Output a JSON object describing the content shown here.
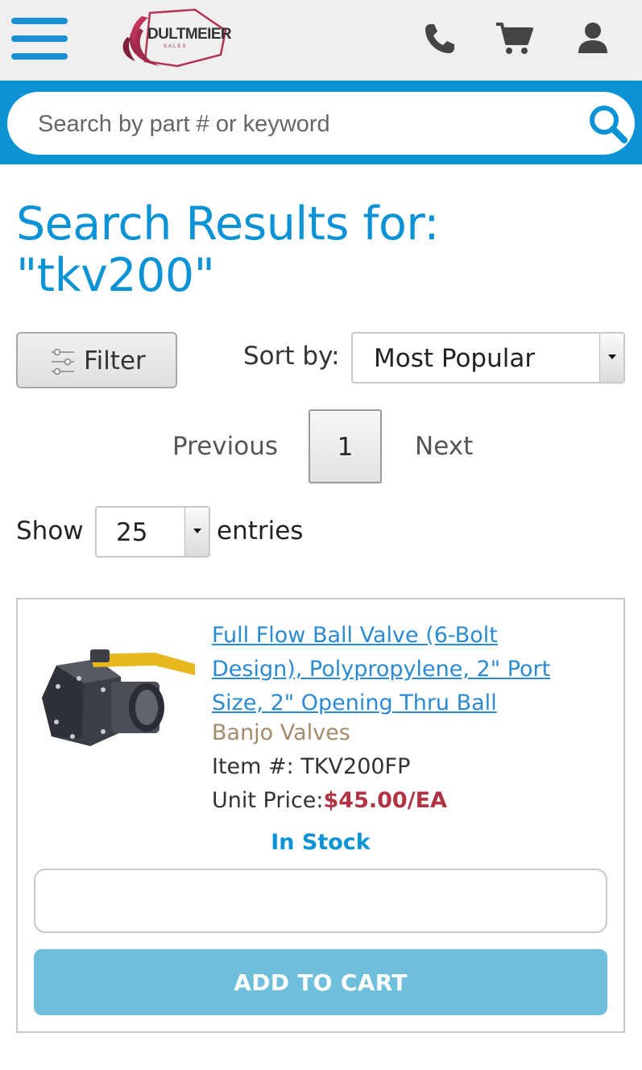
{
  "header": {
    "logo_text": "DULTMEIER",
    "logo_sub": "SALES",
    "icons": [
      "menu-icon",
      "phone-icon",
      "cart-icon",
      "user-icon"
    ]
  },
  "search": {
    "placeholder": "Search by part # or keyword"
  },
  "page_title": "Search Results for: \"tkv200\"",
  "controls": {
    "filter_label": "Filter",
    "sort_label": "Sort by:",
    "sort_value": "Most Popular",
    "show_label": "Show",
    "show_value": "25",
    "entries_label": "entries"
  },
  "pagination": {
    "previous": "Previous",
    "current_page": "1",
    "next": "Next"
  },
  "product": {
    "title": "Full Flow Ball Valve (6-Bolt Design), Polypropylene, 2\" Port Size, 2\" Opening Thru Ball",
    "brand": "Banjo Valves",
    "item_number": "Item #: TKV200FP",
    "price_label": "Unit Price:",
    "price": "$45.00/EA",
    "stock_status": "In Stock",
    "quantity_value": "",
    "add_to_cart_label": "ADD TO CART"
  },
  "colors": {
    "brand_blue": "#0b93d6",
    "price_red": "#b23343",
    "brand_tan": "#a38a6a",
    "add_to_cart_bg": "#6dbfdb"
  }
}
